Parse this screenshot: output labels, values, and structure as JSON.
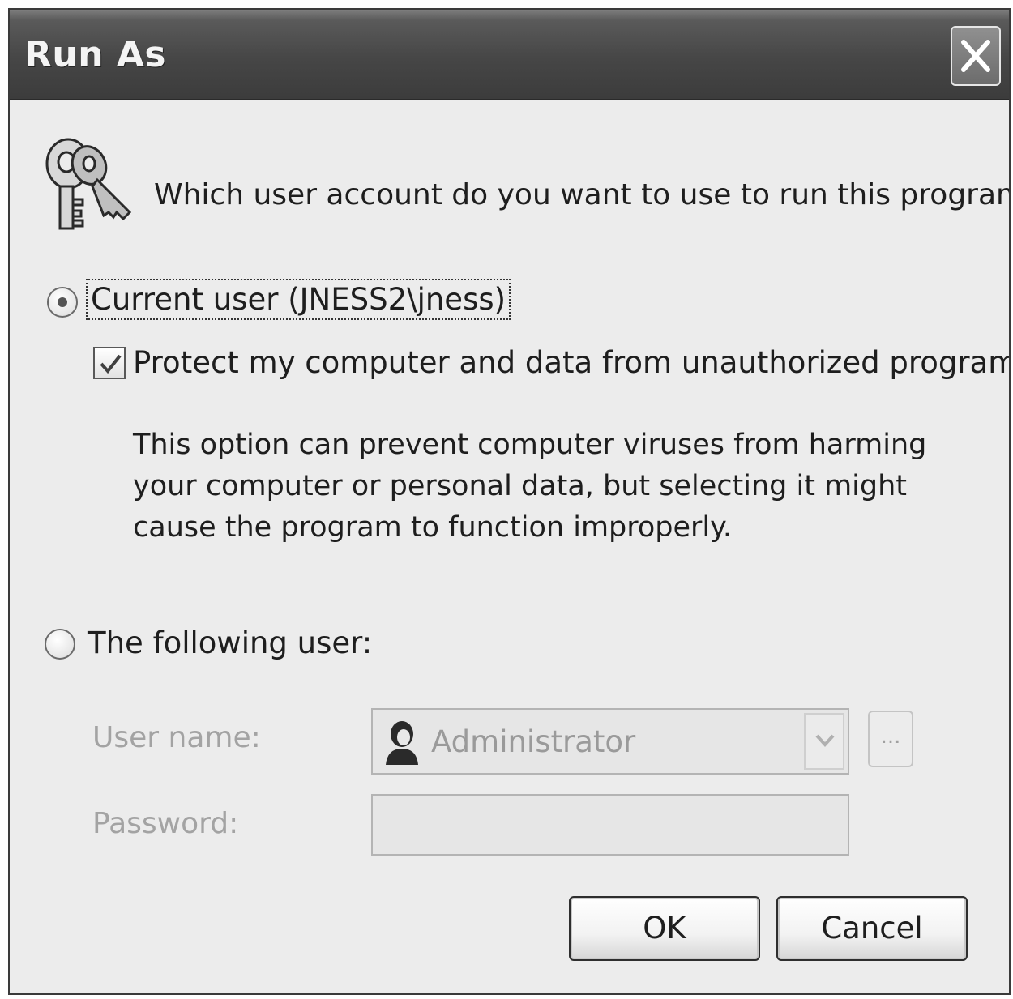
{
  "window": {
    "title": "Run As",
    "close_icon": "close-icon"
  },
  "prompt": {
    "icon": "keys-icon",
    "question": "Which user account do you want to use to run this program?"
  },
  "current_user": {
    "label": "Current user (JNESS2\\jness)",
    "selected": true,
    "protect_option": {
      "label": "Protect my computer and data from unauthorized program activity",
      "checked": true
    },
    "description": "This option can prevent computer viruses from harming your computer or personal data, but selecting it might cause the program to function improperly."
  },
  "following_user": {
    "label": "The following user:",
    "selected": false,
    "username_label": "User name:",
    "username_value": "Administrator",
    "username_icon": "user-icon",
    "browse_label": "...",
    "password_label": "Password:",
    "password_value": ""
  },
  "buttons": {
    "ok": "OK",
    "cancel": "Cancel"
  }
}
